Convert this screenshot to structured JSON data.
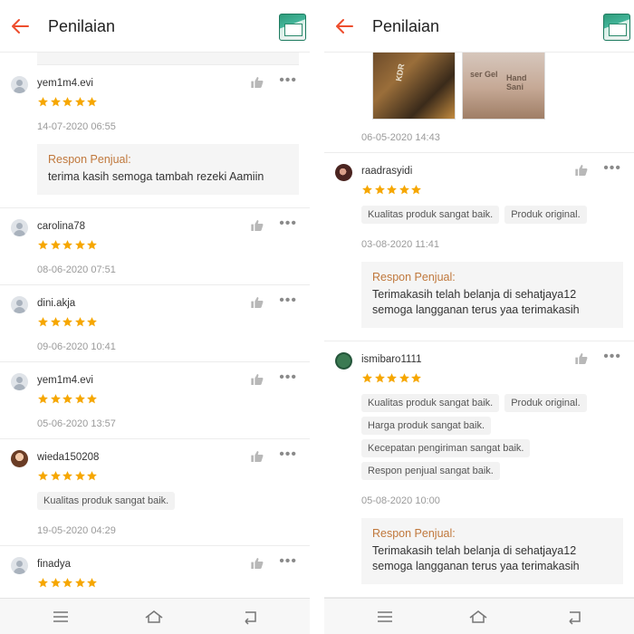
{
  "left": {
    "title": "Penilaian",
    "reviews": [
      {
        "user": "yem1m4.evi",
        "rating": 5,
        "date": "14-07-2020 06:55",
        "respon_label": "Respon Penjual:",
        "respon_text": "terima kasih semoga tambah rezeki Aamiin"
      },
      {
        "user": "carolina78",
        "rating": 5,
        "date": "08-06-2020 07:51"
      },
      {
        "user": "dini.akja",
        "rating": 5,
        "date": "09-06-2020 10:41"
      },
      {
        "user": "yem1m4.evi",
        "rating": 5,
        "date": "05-06-2020 13:57"
      },
      {
        "user": "wieda150208",
        "rating": 5,
        "tags": [
          "Kualitas produk sangat baik."
        ],
        "date": "19-05-2020 04:29"
      },
      {
        "user": "finadya",
        "rating": 5
      }
    ]
  },
  "right": {
    "title": "Penilaian",
    "photo_review_date": "06-05-2020 14:43",
    "photo_texts": [
      "KDR",
      "ser Gel",
      "Hand Sani"
    ],
    "reviews": [
      {
        "user": "raadrasyidi",
        "rating": 5,
        "tags": [
          "Kualitas produk sangat baik.",
          "Produk original."
        ],
        "date": "03-08-2020 11:41",
        "respon_label": "Respon Penjual:",
        "respon_text": "Terimakasih telah belanja di sehatjaya12 semoga langganan terus yaa terimakasih"
      },
      {
        "user": "ismibaro1111",
        "rating": 5,
        "tags": [
          "Kualitas produk sangat baik.",
          "Produk original.",
          "Harga produk sangat baik.",
          "Kecepatan pengiriman sangat baik.",
          "Respon penjual sangat baik."
        ],
        "date": "05-08-2020 10:00",
        "respon_label": "Respon Penjual:",
        "respon_text": "Terimakasih telah belanja di sehatjaya12 semoga langganan terus yaa terimakasih"
      }
    ]
  },
  "icons": {
    "back": "arrow-left-icon",
    "like": "thumbs-up-icon",
    "more": "more-dots-icon",
    "star": "star-icon",
    "nav_menu": "menu-icon",
    "nav_home": "home-icon",
    "nav_back": "back-nav-icon"
  },
  "colors": {
    "accent": "#ee4d2d",
    "star": "#f6a700",
    "respon_label": "#c0783c"
  }
}
